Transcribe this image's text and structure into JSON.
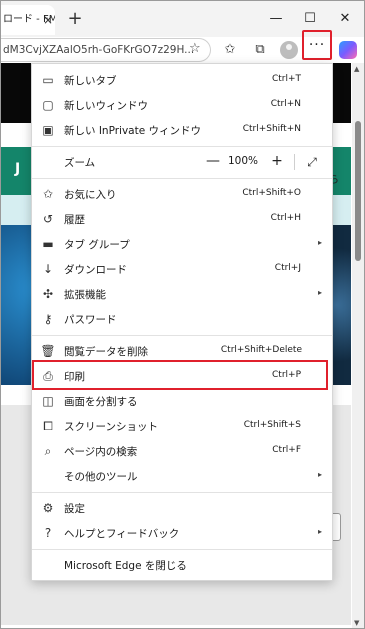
{
  "window": {
    "tab_title": "ロード - FM",
    "tab_close": "×",
    "new_tab": "+",
    "minimize": "—",
    "maximize": "☐",
    "close": "✕"
  },
  "toolbar": {
    "address": "dM3CvjXZAalO5rh-GoFKrGO7z29H...",
    "more_label": "···"
  },
  "page": {
    "teal_text": "J",
    "light_text": "なら",
    "side_box": "ſ"
  },
  "menu": {
    "items": [
      {
        "icon": "new-tab-icon",
        "label": "新しいタブ",
        "shortcut": "Ctrl+T"
      },
      {
        "icon": "new-window-icon",
        "label": "新しいウィンドウ",
        "shortcut": "Ctrl+N"
      },
      {
        "icon": "inprivate-icon",
        "label": "新しい InPrivate ウィンドウ",
        "shortcut": "Ctrl+Shift+N"
      },
      {
        "icon": "zoom",
        "label": "ズーム",
        "zoom_value": "100%"
      },
      {
        "icon": "favorites-icon",
        "label": "お気に入り",
        "shortcut": "Ctrl+Shift+O"
      },
      {
        "icon": "history-icon",
        "label": "履歴",
        "shortcut": "Ctrl+H"
      },
      {
        "icon": "tab-groups-icon",
        "label": "タブ グループ",
        "arrow": "▸"
      },
      {
        "icon": "download-icon",
        "label": "ダウンロード",
        "shortcut": "Ctrl+J"
      },
      {
        "icon": "extensions-icon",
        "label": "拡張機能",
        "arrow": "▸"
      },
      {
        "icon": "key-icon",
        "label": "パスワード"
      },
      {
        "icon": "trash-icon",
        "label": "閲覧データを削除",
        "shortcut": "Ctrl+Shift+Delete"
      },
      {
        "icon": "print-icon",
        "label": "印刷",
        "shortcut": "Ctrl+P"
      },
      {
        "icon": "split-screen-icon",
        "label": "画面を分割する"
      },
      {
        "icon": "screenshot-icon",
        "label": "スクリーンショット",
        "shortcut": "Ctrl+Shift+S"
      },
      {
        "icon": "find-icon",
        "label": "ページ内の検索",
        "shortcut": "Ctrl+F"
      },
      {
        "icon": "",
        "label": "その他のツール",
        "arrow": "▸"
      },
      {
        "icon": "settings-icon",
        "label": "設定"
      },
      {
        "icon": "help-icon",
        "label": "ヘルプとフィードバック",
        "arrow": "▸"
      },
      {
        "icon": "",
        "label": "Microsoft Edge を閉じる"
      }
    ]
  },
  "colors": {
    "highlight": "#e0202c",
    "teal": "#14856a"
  }
}
